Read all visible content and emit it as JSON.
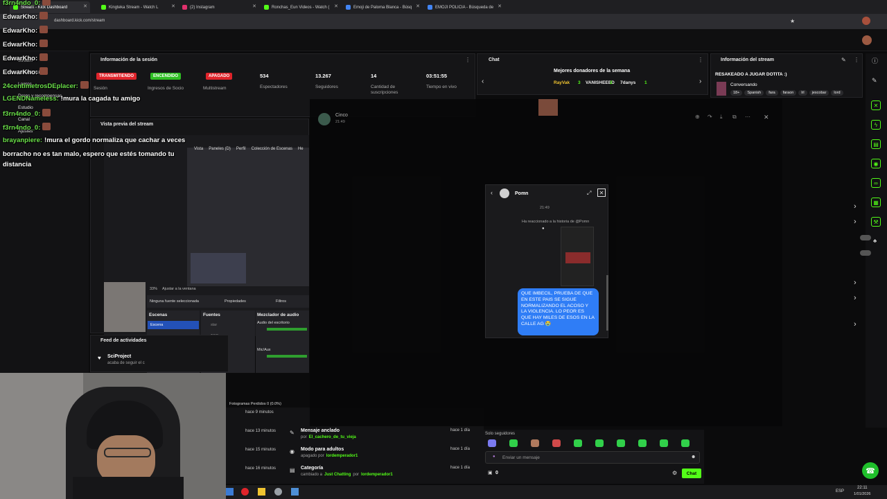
{
  "browser": {
    "tabs": [
      {
        "label": "Stream - Kick Dashboard",
        "active": true,
        "color": "#53fc18"
      },
      {
        "label": "Kingteka Stream - Watch L",
        "active": false,
        "color": "#53fc18"
      },
      {
        "label": "(2) Instagram",
        "active": false,
        "color": "#e1306c"
      },
      {
        "label": "Ronchas_Eun Videos - Watch (",
        "active": false,
        "color": "#53fc18"
      },
      {
        "label": "Emoji de Paloma Blanca - Búsq",
        "active": false,
        "color": "#4285f4"
      },
      {
        "label": "EMOJI POLICIA - Búsqueda de",
        "active": false,
        "color": "#4285f4"
      }
    ],
    "url": "dashboard.kick.com/stream"
  },
  "overlay_chat": [
    {
      "user": "f3rn4ndo_0:",
      "text": "",
      "color": "green",
      "emote": true
    },
    {
      "user": "EdwarKho:",
      "text": "",
      "color": "white",
      "emote": true
    },
    {
      "user": "EdwarKho:",
      "text": "",
      "color": "white",
      "emote": true
    },
    {
      "user": "EdwarKho:",
      "text": "",
      "color": "white",
      "emote": true
    },
    {
      "user": "EdwarKho:",
      "text": "",
      "color": "white",
      "emote": true
    },
    {
      "user": "EdwarKho:",
      "text": "",
      "color": "white",
      "emote": true
    },
    {
      "user": "24centimetrosDEplacer:",
      "text": "",
      "color": "green",
      "emote": true
    },
    {
      "user": "LGENDNameless:",
      "text": "!mura la cagada tu amigo",
      "color": "green",
      "emote": false
    },
    {
      "user": "f3rn4ndo_0:",
      "text": "",
      "color": "green",
      "emote": true
    },
    {
      "user": "f3rn4ndo_0:",
      "text": "",
      "color": "green",
      "emote": true
    },
    {
      "user": "brayanpiere:",
      "text": "!mura el gordo normaliza que cachar a veces",
      "color": "green",
      "emote": false
    }
  ],
  "overlay_tail": [
    "borracho no es tan malo, espero que estés tomando tu",
    "distancia"
  ],
  "sidebar": {
    "items": [
      "Stream",
      "Monetización",
      "Logros",
      "Drops y recompensas",
      "Estudio",
      "Canal",
      "Ajustes"
    ]
  },
  "session": {
    "title": "Información de la sesión",
    "badges": [
      {
        "label": "TRANSMITIENDO",
        "color": "#e0242b",
        "caption": "Sesión"
      },
      {
        "label": "ENCENDIDO",
        "color": "#2fbf24",
        "caption": "Ingresos de Socio"
      },
      {
        "label": "APAGADO",
        "color": "#e0242b",
        "caption": "Multistream"
      }
    ],
    "stats": [
      {
        "value": "534",
        "label": "Espectadores"
      },
      {
        "value": "13.267",
        "label": "Seguidores"
      },
      {
        "value": "14",
        "label": "Cantidad de suscripciones"
      },
      {
        "value": "03:51:55",
        "label": "Tiempo en vivo"
      }
    ]
  },
  "preview": {
    "title": "Vista previa del stream"
  },
  "activity": {
    "title": "Feed de actividades",
    "first_user": "SciProject",
    "first_action": "acaba de seguir el c",
    "times": [
      "hace 9 minutos",
      "hace 13 minutos",
      "hace 15 minutos",
      "hace 16 minutos"
    ],
    "events": [
      {
        "title": "Mensaje anclado",
        "by_prefix": "por",
        "user": "El_cachero_de_tu_vieja",
        "time": "hace 1 día"
      },
      {
        "title": "Modo para adultos",
        "by_prefix": "apagado por",
        "user": "lordemperador1",
        "time": "hace 1 día"
      },
      {
        "title": "Categoría",
        "by_prefix": "cambiado a",
        "user": "Just Chatting",
        "suffix": "por",
        "user2": "lordemperador1",
        "time": "hace 1 día"
      }
    ]
  },
  "chat": {
    "title": "Chat",
    "donors_title": "Mejores donadores de la semana",
    "donors": [
      {
        "name": "RayVak",
        "count": "3"
      },
      {
        "name": "VANISHEEED",
        "count": "2"
      },
      {
        "name": "7danys",
        "count": "1"
      }
    ],
    "followers_only": "Solo seguidores",
    "input_placeholder": "Enviar un mensaje",
    "send_label": "Chat",
    "points": "0"
  },
  "stream_info": {
    "title": "Información del stream",
    "stream_title": "RESAKEADO A JUGAR DOTITA :)",
    "category": "Conversando",
    "tags": [
      "18+",
      "Spanish",
      "fara",
      "faraon",
      "lrl",
      "jescobar",
      "lord"
    ]
  },
  "obs": {
    "menu": [
      "Vista",
      "Paneles (D)",
      "Perfil",
      "Colección de Escenas",
      "He"
    ],
    "no_source": "Ninguna fuente seleccionada",
    "properties": "Propiedades",
    "filters": "Filtros",
    "scenes_title": "Escenas",
    "scene_item": "Escena",
    "sources_title": "Fuentes",
    "sources": [
      "star",
      "TOP",
      "contado",
      "gta",
      "free fire"
    ],
    "mixer_title": "Mezclador de audio",
    "mixer_items": [
      "Audio del escritorio",
      "Mic/Aux"
    ],
    "dropped_frames": "Fotogramas Perdidos 0 (0.0%)",
    "zoom": "33%",
    "fit": "Ajustar a la ventana"
  },
  "viewer_overlay": {
    "user": "Cinco",
    "time": "21:49",
    "dm_name": "Pomn",
    "dm_time": "21:49",
    "reaction_text": "Ha reaccionado a la historia de @Pomn",
    "message": "QUE IMBECIL, PRUEBA DE QUE EN ESTE PAIS SE SIGUE NORMALIZANDO EL ACOSO Y LA VIOLENCIA. LO PEOR ES QUE HAY MILES DE ESOS EN LA CALLE AG 😭"
  },
  "taskbar": {
    "lang": "ESP",
    "time": "22:11",
    "date": "1/01/2026"
  }
}
